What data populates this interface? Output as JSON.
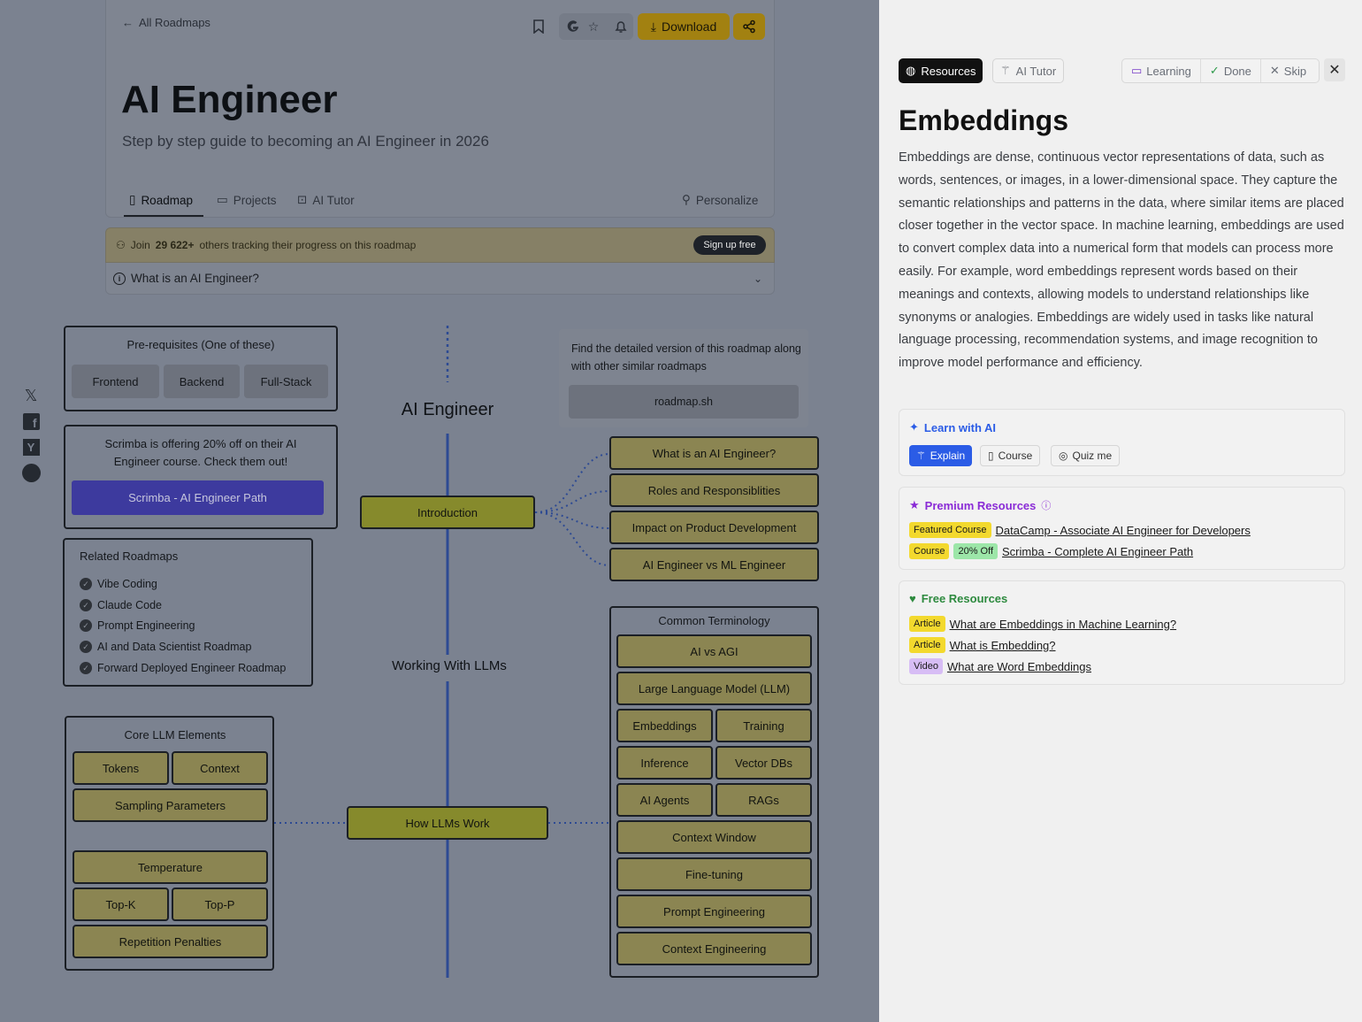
{
  "header": {
    "back_label": "All Roadmaps",
    "download_label": "Download",
    "title": "AI Engineer",
    "subtitle": "Step by step guide to becoming an AI Engineer in 2026",
    "tabs": [
      {
        "label": "Roadmap",
        "icon": "map-icon",
        "active": true
      },
      {
        "label": "Projects",
        "icon": "projects-icon"
      },
      {
        "label": "AI Tutor",
        "icon": "robot-icon"
      }
    ],
    "personalize_label": "Personalize",
    "join_prefix": "Join",
    "join_count": "29 622+",
    "join_suffix": "others tracking their progress on this roadmap",
    "signup_label": "Sign up free",
    "what_is_label": "What is an AI Engineer?"
  },
  "social": [
    "x-icon",
    "facebook-icon",
    "hackernews-icon",
    "reddit-icon"
  ],
  "roadmap": {
    "prereq_title": "Pre-requisites (One of these)",
    "prereqs": [
      "Frontend",
      "Backend",
      "Full-Stack"
    ],
    "promo_text": "Scrimba is offering 20% off on their AI Engineer course. Check them out!",
    "promo_button": "Scrimba - AI Engineer Path",
    "related_title": "Related Roadmaps",
    "related": [
      "Vibe Coding",
      "Claude Code",
      "Prompt Engineering",
      "AI and Data Scientist Roadmap",
      "Forward Deployed Engineer Roadmap"
    ],
    "center_title": "AI Engineer",
    "detail_text": "Find the detailed version of this roadmap along with other similar roadmaps",
    "detail_button": "roadmap.sh",
    "intro_label": "Introduction",
    "intro_items": [
      "What is an AI Engineer?",
      "Roles and Responsiblities",
      "Impact on Product Development",
      "AI Engineer vs ML Engineer"
    ],
    "working_label": "Working With LLMs",
    "terminology_title": "Common Terminology",
    "terminology": {
      "ai_vs_agi": "AI vs AGI",
      "llm": "Large Language Model (LLM)",
      "embeddings": "Embeddings",
      "training": "Training",
      "inference": "Inference",
      "vector_dbs": "Vector DBs",
      "ai_agents": "AI Agents",
      "rags": "RAGs",
      "context_window": "Context Window",
      "fine_tuning": "Fine-tuning",
      "prompt_engineering": "Prompt Engineering",
      "context_engineering": "Context Engineering"
    },
    "core_title": "Core LLM Elements",
    "core": {
      "tokens": "Tokens",
      "context": "Context",
      "sampling": "Sampling Parameters",
      "temperature": "Temperature",
      "top_k": "Top-K",
      "top_p": "Top-P",
      "repetition": "Repetition Penalties"
    },
    "how_llms_work": "How LLMs Work"
  },
  "panel": {
    "resources_label": "Resources",
    "ai_tutor_label": "AI Tutor",
    "learning_label": "Learning",
    "done_label": "Done",
    "skip_label": "Skip",
    "title": "Embeddings",
    "description": "Embeddings are dense, continuous vector representations of data, such as words, sentences, or images, in a lower-dimensional space. They capture the semantic relationships and patterns in the data, where similar items are placed closer together in the vector space. In machine learning, embeddings are used to convert complex data into a numerical form that models can process more easily. For example, word embeddings represent words based on their meanings and contexts, allowing models to understand relationships like synonyms or analogies. Embeddings are widely used in tasks like natural language processing, recommendation systems, and image recognition to improve model performance and efficiency.",
    "learn_ai": {
      "title": "Learn with AI",
      "explain": "Explain",
      "course": "Course",
      "quiz": "Quiz me"
    },
    "premium": {
      "title": "Premium Resources",
      "items": [
        {
          "badges": [
            "Featured Course"
          ],
          "title": "DataCamp - Associate AI Engineer for Developers"
        },
        {
          "badges": [
            "Course",
            "20% Off"
          ],
          "title": "Scrimba - Complete AI Engineer Path"
        }
      ]
    },
    "free": {
      "title": "Free Resources",
      "items": [
        {
          "type": "Article",
          "title": "What are Embeddings in Machine Learning?"
        },
        {
          "type": "Article",
          "title": "What is Embedding?"
        },
        {
          "type": "Video",
          "title": "What are Word Embeddings"
        }
      ]
    }
  },
  "colors": {
    "accent_yellow": "#a28111",
    "node_fill": "#8b8552",
    "topic_fill": "#868a2c",
    "spine_blue": "#2d4a93",
    "premium_purple": "#8a2bd6",
    "free_green": "#2d8a3e",
    "learn_blue": "#2b5ce6"
  }
}
